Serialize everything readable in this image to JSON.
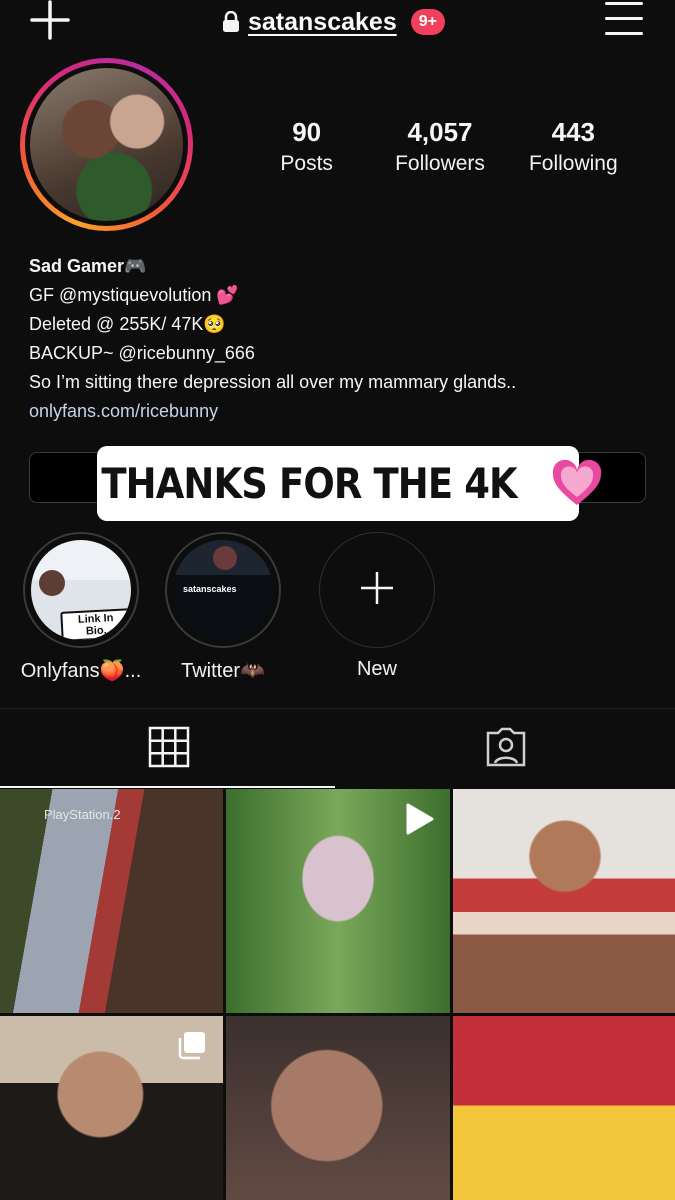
{
  "header": {
    "username": "satanscakes",
    "notification_badge": "9+",
    "icons": [
      "plus-icon",
      "lock-icon",
      "menu-icon"
    ]
  },
  "profile": {
    "stats": [
      {
        "value": "90",
        "label": "Posts"
      },
      {
        "value": "4,057",
        "label": "Followers"
      },
      {
        "value": "443",
        "label": "Following"
      }
    ],
    "bio": {
      "name": "Sad Gamer🎮",
      "lines": [
        "GF @mystiquevolution 💕",
        "Deleted @ 255K/ 47K🥺",
        "BACKUP~ @ricebunny_666",
        "So I’m sitting there depression all over my mammary glands.."
      ],
      "link": "onlyfans.com/ricebunny"
    }
  },
  "sticker": {
    "text": "THANKS FOR THE 4K",
    "icon": "sparkling-heart-icon",
    "color": "#e94aa0"
  },
  "highlights": [
    {
      "label": "Onlyfans🍑...",
      "overlay_text": "Link In Bio."
    },
    {
      "label": "Twitter🦇",
      "overlay_text": "satanscakes"
    },
    {
      "label": "New"
    }
  ],
  "tabs": [
    {
      "name": "grid",
      "icon": "grid-icon",
      "active": true
    },
    {
      "name": "tagged",
      "icon": "tagged-person-icon",
      "active": false
    }
  ],
  "posts": [
    {
      "type": "image",
      "text": "PlayStation.2"
    },
    {
      "type": "reel",
      "icon": "play-icon"
    },
    {
      "type": "image"
    },
    {
      "type": "carousel",
      "icon": "carousel-icon"
    },
    {
      "type": "image"
    },
    {
      "type": "image"
    }
  ],
  "colors": {
    "background": "#0d0d0d",
    "badge": "#f0405b",
    "link": "#c7d3ec"
  }
}
